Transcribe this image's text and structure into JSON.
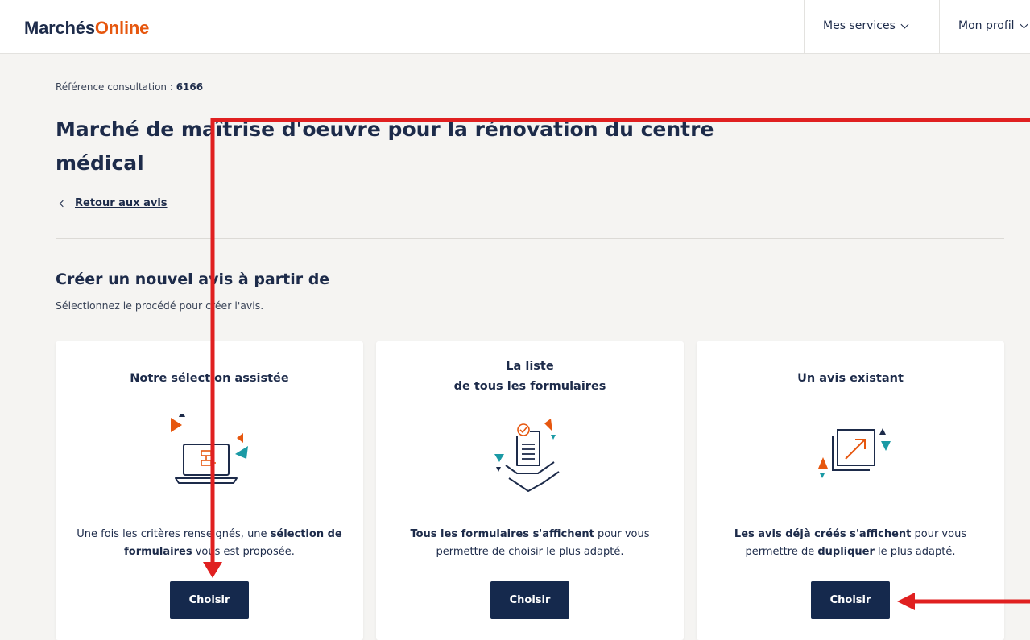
{
  "header": {
    "logo_part1": "Marchés",
    "logo_part2": "Online",
    "nav": [
      {
        "label": "Mes services"
      },
      {
        "label": "Mon profil"
      }
    ]
  },
  "page": {
    "reference_label": "Référence consultation : ",
    "reference_value": "6166",
    "title": "Marché de maîtrise d'oeuvre pour la rénovation du centre médical",
    "back_link": "Retour aux avis",
    "section_title": "Créer un nouvel avis à partir de",
    "section_subtitle": "Sélectionnez le procédé pour créer l'avis."
  },
  "cards": [
    {
      "title_line1": "Notre sélection assistée",
      "title_line2": "",
      "icon": "laptop-icon",
      "desc_parts": [
        "Une fois les critères renseignés, une ",
        "sélection de formulaires",
        " vous est proposée."
      ],
      "button": "Choisir"
    },
    {
      "title_line1": "La liste",
      "title_line2": "de tous les formulaires",
      "icon": "document-hand-icon",
      "desc_parts": [
        "Tous les formulaires s'affichent",
        " pour vous permettre de choisir le plus adapté."
      ],
      "button": "Choisir"
    },
    {
      "title_line1": "Un avis existant",
      "title_line2": "",
      "icon": "duplicate-icon",
      "desc_parts": [
        "Les avis déjà créés s'affichent",
        " pour vous permettre de ",
        "dupliquer",
        " le plus adapté."
      ],
      "button": "Choisir"
    }
  ],
  "colors": {
    "brand_dark": "#1d2b4a",
    "brand_orange": "#e6570f",
    "accent_teal": "#1b9aa5",
    "button_bg": "#15294d",
    "annotation_red": "#e02020"
  }
}
